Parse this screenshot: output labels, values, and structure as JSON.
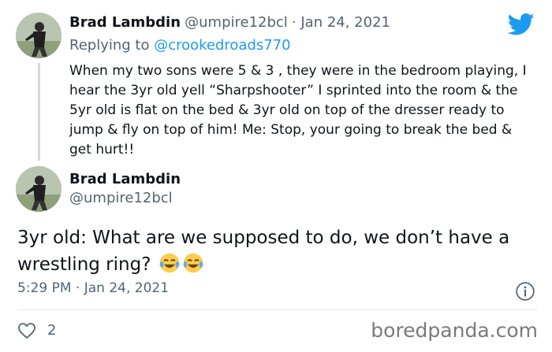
{
  "colors": {
    "accent": "#1d9bf0",
    "muted": "#536471",
    "text": "#0f1419"
  },
  "reply_tweet": {
    "author_name": "Brad Lambdin",
    "handle": "@umpire12bcl",
    "date": "· Jan 24, 2021",
    "replying_label": "Replying to",
    "replying_to": "@crookedroads770",
    "text": "When my two sons were 5 & 3 , they were in the bedroom playing, I hear the 3yr old yell “Sharpshooter” I sprinted into the room & the 5yr old is flat on the bed & 3yr old on top of the dresser ready to jump & fly on top of him! Me: Stop, your going to break the bed & get hurt!!"
  },
  "main_tweet": {
    "author_name": "Brad Lambdin",
    "handle": "@umpire12bcl",
    "text": "3yr old: What are we supposed to do, we don’t have a wrestling ring?",
    "timestamp": "5:29 PM · Jan 24, 2021",
    "likes": "2"
  },
  "icons": [
    "twitter-logo-icon",
    "avatar",
    "tears-of-joy-emoji-icon",
    "info-icon",
    "heart-icon"
  ],
  "watermark": "boredpanda.com"
}
